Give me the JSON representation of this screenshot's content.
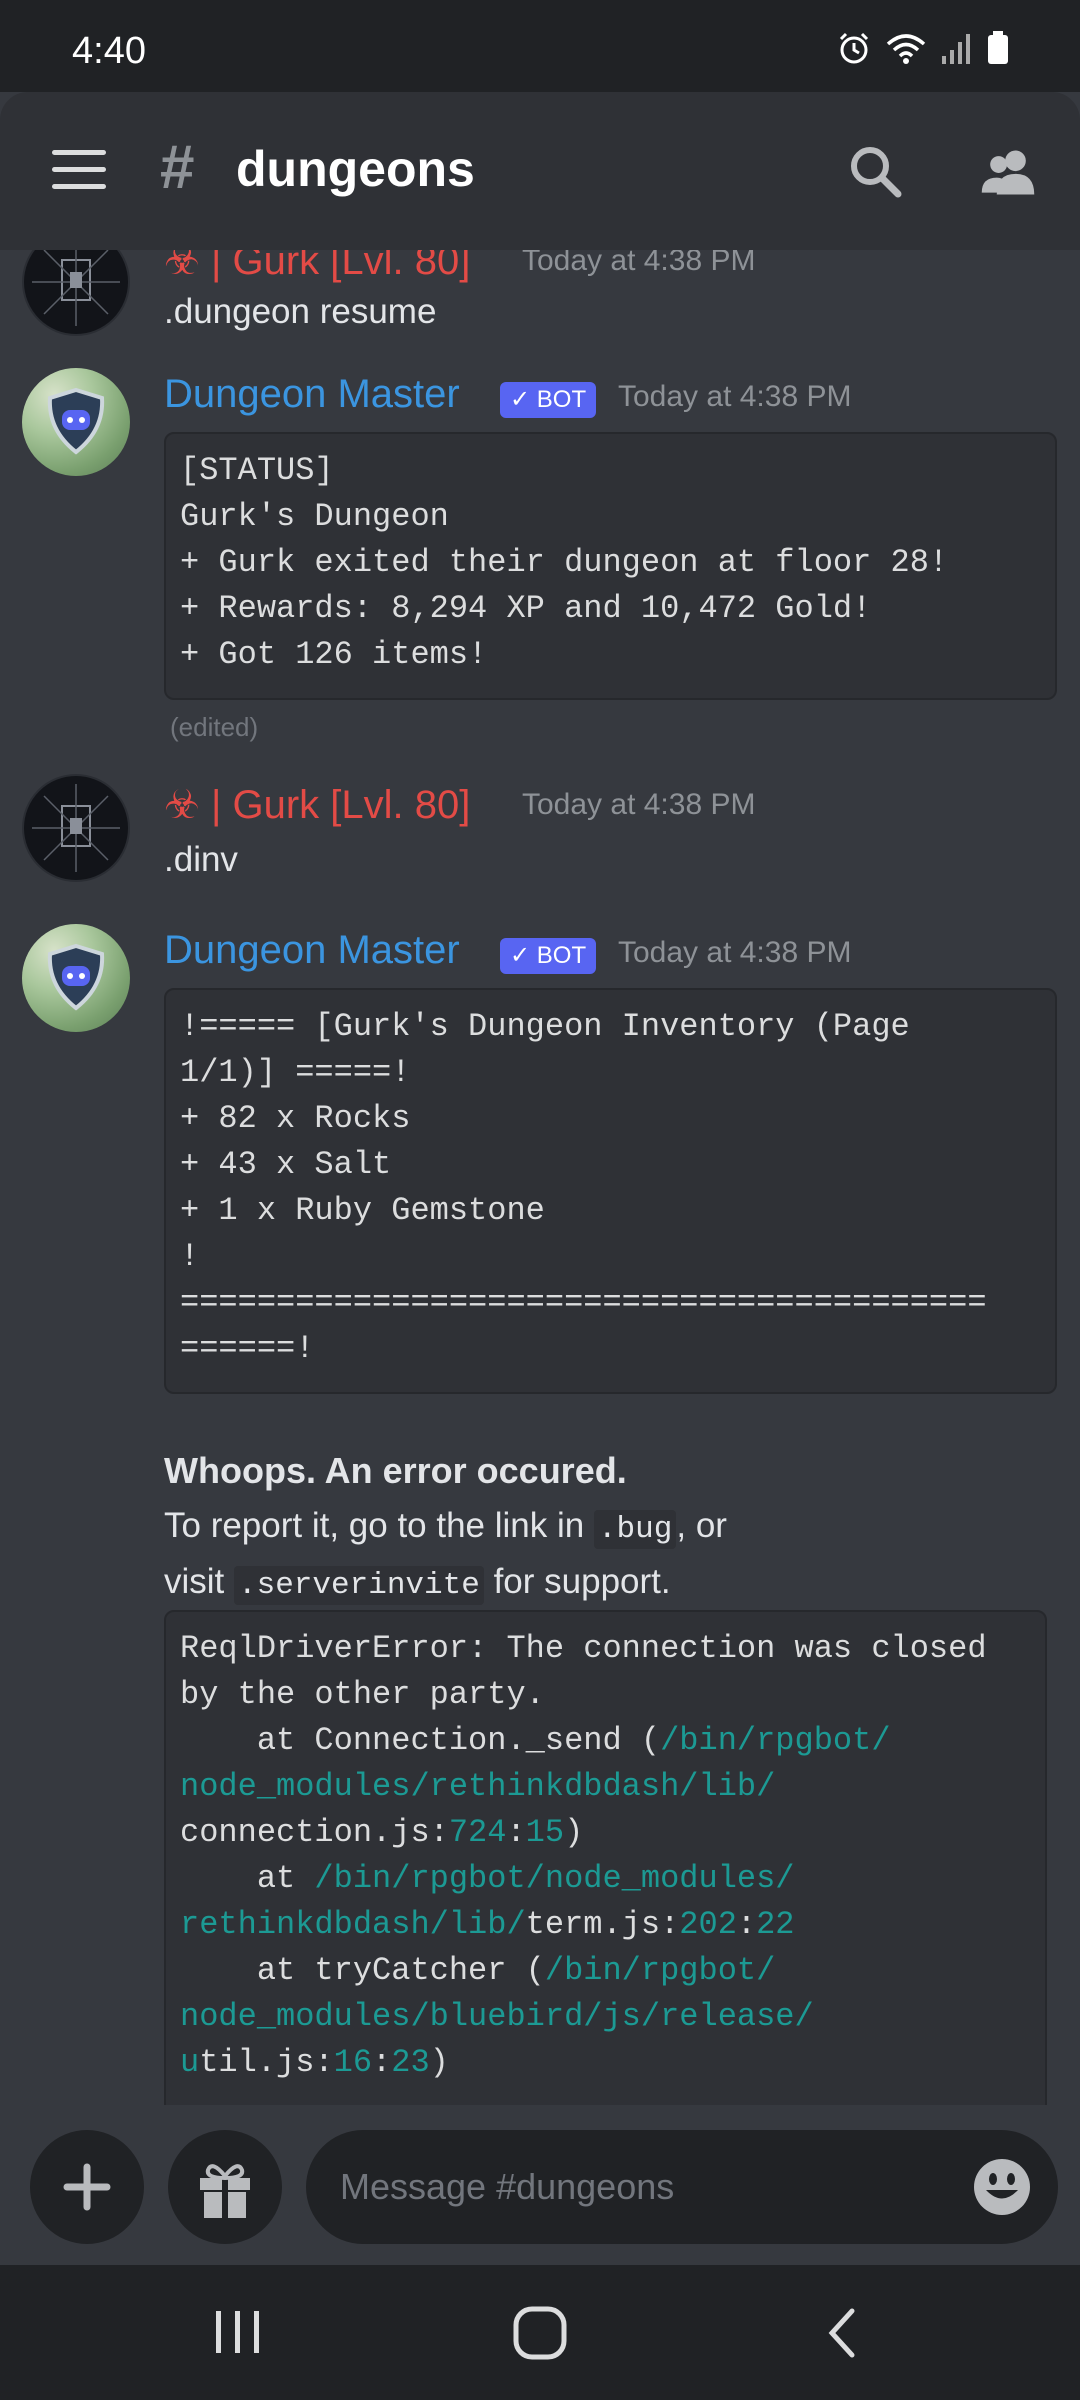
{
  "status_bar": {
    "time": "4:40",
    "icons": [
      "alarm-icon",
      "wifi-icon",
      "signal-icon",
      "battery-icon"
    ]
  },
  "header": {
    "hash": "#",
    "channel": "dungeons"
  },
  "messages": [
    {
      "author": "☣ | Gurk [Lvl. 80]",
      "timestamp": "Today at 4:38 PM",
      "text": ".dungeon resume"
    },
    {
      "author": "Dungeon Master",
      "badge": "✓ BOT",
      "timestamp": "Today at 4:38 PM",
      "code": "[STATUS]\nGurk's Dungeon\n+ Gurk exited their dungeon at floor 28!\n+ Rewards: 8,294 XP and 10,472 Gold!\n+ Got 126 items!",
      "edited": "(edited)"
    },
    {
      "author": "☣ | Gurk [Lvl. 80]",
      "timestamp": "Today at 4:38 PM",
      "text": ".dinv"
    },
    {
      "author": "Dungeon Master",
      "badge": "✓ BOT",
      "timestamp": "Today at 4:38 PM",
      "code": "!===== [Gurk's Dungeon Inventory (Page\n1/1)] =====!\n+ 82 x Rocks\n+ 43 x Salt\n+ 1 x Ruby Gemstone\n!\n==========================================\n======!",
      "error_title": "Whoops. An error occured.",
      "error_line1_pre": "To report it, go to the link in ",
      "error_line1_code": ".bug",
      "error_line1_post": ", or",
      "error_line2_pre": "visit ",
      "error_line2_code": ".serverinvite",
      "error_line2_post": " for support.",
      "error_trace": [
        [
          "ReqlDriverError: The connection was closed",
          ""
        ],
        [
          "by the other party.",
          ""
        ],
        [
          "    at Connection._send (",
          "/bin/rpgbot/"
        ],
        [
          "",
          "node_modules/rethinkdbdash/lib/"
        ],
        [
          "connection.js:",
          "724",
          ":",
          "15",
          ")"
        ],
        [
          "    at ",
          "/bin/rpgbot/node_modules/"
        ],
        [
          "",
          "rethinkdbdash/lib/",
          "term.js:",
          "202",
          ":",
          "22"
        ],
        [
          "    at tryCatcher (",
          "/bin/rpgbot/"
        ],
        [
          "",
          "node_modules/bluebird/js/release/"
        ],
        [
          "u",
          "til.js:",
          "16",
          ":",
          "23",
          ")"
        ]
      ]
    }
  ],
  "input": {
    "placeholder": "Message #dungeons"
  },
  "colors": {
    "bg": "#36393f",
    "header": "#2f3136",
    "bar": "#202225",
    "username_red": "#e34b46",
    "username_blue": "#3b95e0",
    "bot_badge": "#5865f2",
    "link_teal": "#1c9a94"
  }
}
